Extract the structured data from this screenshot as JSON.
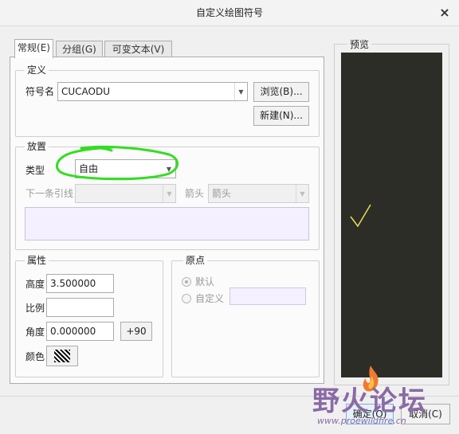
{
  "window": {
    "title": "自定义绘图符号"
  },
  "tabs": [
    {
      "label": "常规(E)"
    },
    {
      "label": "分组(G)"
    },
    {
      "label": "可变文本(V)"
    }
  ],
  "definition": {
    "group_label": "定义",
    "symbol_name_label": "符号名",
    "symbol_name_value": "CUCAODU",
    "browse_button": "浏览(B)...",
    "new_button": "新建(N)..."
  },
  "placement": {
    "group_label": "放置",
    "type_label": "类型",
    "type_value": "自由",
    "next_leader_label": "下一条引线",
    "next_leader_value": "",
    "arrow_label": "箭头",
    "arrow_value": "箭头"
  },
  "properties": {
    "group_label": "属性",
    "height_label": "高度",
    "height_value": "3.500000",
    "scale_label": "比例",
    "scale_value": "",
    "angle_label": "角度",
    "angle_value": "0.000000",
    "plus90_button": "+90",
    "color_label": "颜色"
  },
  "origin": {
    "group_label": "原点",
    "default_label": "默认",
    "custom_label": "自定义"
  },
  "preview": {
    "group_label": "预览",
    "symbol_color": "#e8dd55",
    "canvas_color": "#2d2d27"
  },
  "footer": {
    "ok_button": "确定(O)",
    "cancel_button": "取消(C)"
  },
  "watermark": {
    "text": "野火论坛",
    "url": "www.proewildfire.cn"
  },
  "colors": {
    "highlight_circle": "#33dd22",
    "watermark": "#8a6aa5"
  }
}
